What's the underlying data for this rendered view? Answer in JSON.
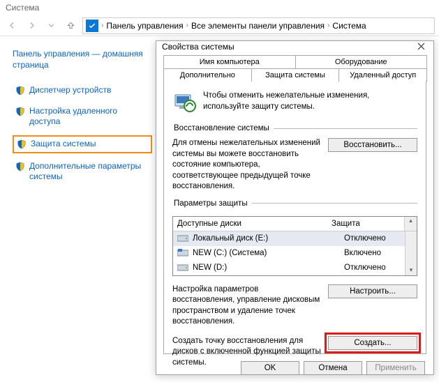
{
  "explorer": {
    "title": "Система",
    "breadcrumb": [
      "Панель управления",
      "Все элементы панели управления",
      "Система"
    ]
  },
  "sidebar": {
    "home": "Панель управления — домашняя страница",
    "links": [
      "Диспетчер устройств",
      "Настройка удаленного доступа",
      "Защита системы",
      "Дополнительные параметры системы"
    ]
  },
  "dialog": {
    "title": "Свойства системы",
    "tabs_row1": [
      "Имя компьютера",
      "Оборудование"
    ],
    "tabs_row2": [
      "Дополнительно",
      "Защита системы",
      "Удаленный доступ"
    ],
    "selected_tab": "Защита системы",
    "intro": "Чтобы отменить нежелательные изменения, используйте защиту системы.",
    "restore_group": "Восстановление системы",
    "restore_text": "Для отмены нежелательных изменений системы вы можете восстановить состояние компьютера, соответствующее предыдущей точке восстановления.",
    "restore_btn": "Восстановить...",
    "params_group": "Параметры защиты",
    "table_headers": [
      "Доступные диски",
      "Защита"
    ],
    "disks": [
      {
        "name": "Локальный диск (E:)",
        "protection": "Отключено"
      },
      {
        "name": "NEW (C:) (Система)",
        "protection": "Включено"
      },
      {
        "name": "NEW (D:)",
        "protection": "Отключено"
      }
    ],
    "configure_text": "Настройка параметров восстановления, управление дисковым пространством и удаление точек восстановления.",
    "configure_btn": "Настроить...",
    "create_text": "Создать точку восстановления для дисков с включенной функцией защиты системы.",
    "create_btn": "Создать...",
    "footer": {
      "ok": "OK",
      "cancel": "Отмена",
      "apply": "Применить"
    }
  }
}
